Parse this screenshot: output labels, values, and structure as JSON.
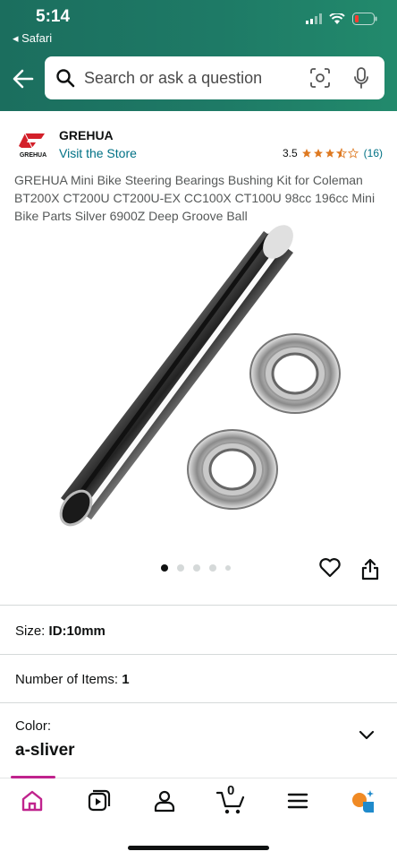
{
  "status_bar": {
    "time": "5:14",
    "back_app": "◂ Safari",
    "icons": [
      "signal-icon",
      "wifi-icon",
      "battery-low-icon"
    ]
  },
  "search": {
    "placeholder": "Search or ask a question",
    "icons": [
      "back-arrow-icon",
      "search-icon",
      "camera-scan-icon",
      "microphone-icon"
    ]
  },
  "product": {
    "brand": "GREHUA",
    "brand_logo_text": "GREHUA",
    "store_link": "Visit the Store",
    "rating": "3.5",
    "rating_stars_value": 3.5,
    "review_count": "(16)",
    "title": "GREHUA Mini Bike Steering Bearings Bushing Kit for Coleman BT200X CT200U CT200U-EX CC100X CT100U 98cc 196cc Mini Bike Parts Silver 6900Z Deep Groove Ball",
    "image_count": 5,
    "active_image": 1
  },
  "options": {
    "size_label": "Size:",
    "size_value": "ID:10mm",
    "items_label": "Number of Items:",
    "items_value": "1",
    "color_label": "Color:",
    "color_value": "a-sliver"
  },
  "tabbar": {
    "tabs": [
      "home-icon",
      "video-icon",
      "account-icon",
      "cart-icon",
      "menu-icon",
      "rufus-icon"
    ],
    "cart_count": "0",
    "active_tab": "home"
  },
  "colors": {
    "header_bg": "#1e7a66",
    "link": "#007185",
    "star": "#de7921",
    "active_tab": "#c0238d"
  }
}
